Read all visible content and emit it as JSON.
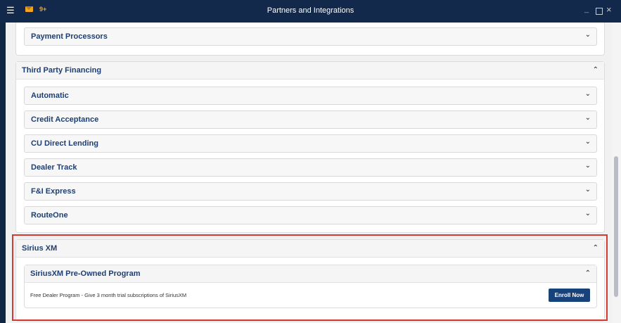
{
  "window": {
    "title": "Partners and Integrations",
    "menu_icon": "hamburger-menu-icon",
    "mail_icon": "envelope-icon",
    "notification_count": "9+",
    "controls": {
      "minimize": "_",
      "maximize": "□",
      "close": "×"
    }
  },
  "colors": {
    "titlebar": "#13294b",
    "accent": "#1d3f73",
    "button": "#18427a",
    "highlight": "#d23a32"
  },
  "sections": {
    "payment": {
      "row": "Payment Processors"
    },
    "financing": {
      "title": "Third Party Financing",
      "rows": [
        "Automatic",
        "Credit Acceptance",
        "CU Direct Lending",
        "Dealer Track",
        "F&I Express",
        "RouteOne"
      ]
    },
    "sirius": {
      "title": "Sirius XM",
      "program": {
        "title": "SiriusXM Pre-Owned Program",
        "description": "Free Dealer Program - Give 3 month trial subscriptions of SiriusXM",
        "button": "Enroll Now"
      }
    }
  }
}
